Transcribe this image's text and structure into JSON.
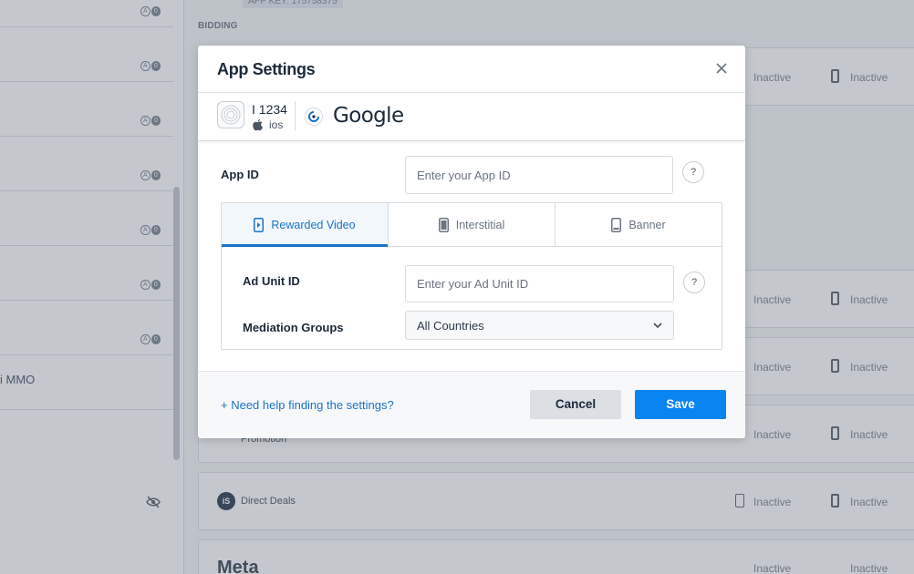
{
  "background": {
    "app_key": "APP KEY: 175758375",
    "section_label": "BIDDING",
    "left_text": "i MMO",
    "status_label": "Inactive",
    "direct_deals_label": "Direct Deals",
    "promotion_label": "Promotion",
    "meta_label": "Meta"
  },
  "modal": {
    "title": "App Settings",
    "app": {
      "name": "I 1234",
      "os": "ios"
    },
    "network": {
      "name": "Google"
    },
    "app_id": {
      "label": "App ID",
      "placeholder": "Enter your App ID",
      "help": "?"
    },
    "tabs": [
      {
        "label": "Rewarded Video",
        "active": true,
        "icon": "rewarded-video-icon"
      },
      {
        "label": "Interstitial",
        "active": false,
        "icon": "interstitial-icon"
      },
      {
        "label": "Banner",
        "active": false,
        "icon": "banner-icon"
      }
    ],
    "ad_unit": {
      "label": "Ad Unit ID",
      "placeholder": "Enter your Ad Unit ID",
      "help": "?"
    },
    "mediation": {
      "label": "Mediation Groups",
      "selected": "All Countries"
    },
    "footer": {
      "help_link": "+ Need help finding the settings?",
      "cancel": "Cancel",
      "save": "Save"
    }
  },
  "colors": {
    "accent": "#1a73c8",
    "save_button": "#0a84f0",
    "overlay": "#737d8a"
  }
}
